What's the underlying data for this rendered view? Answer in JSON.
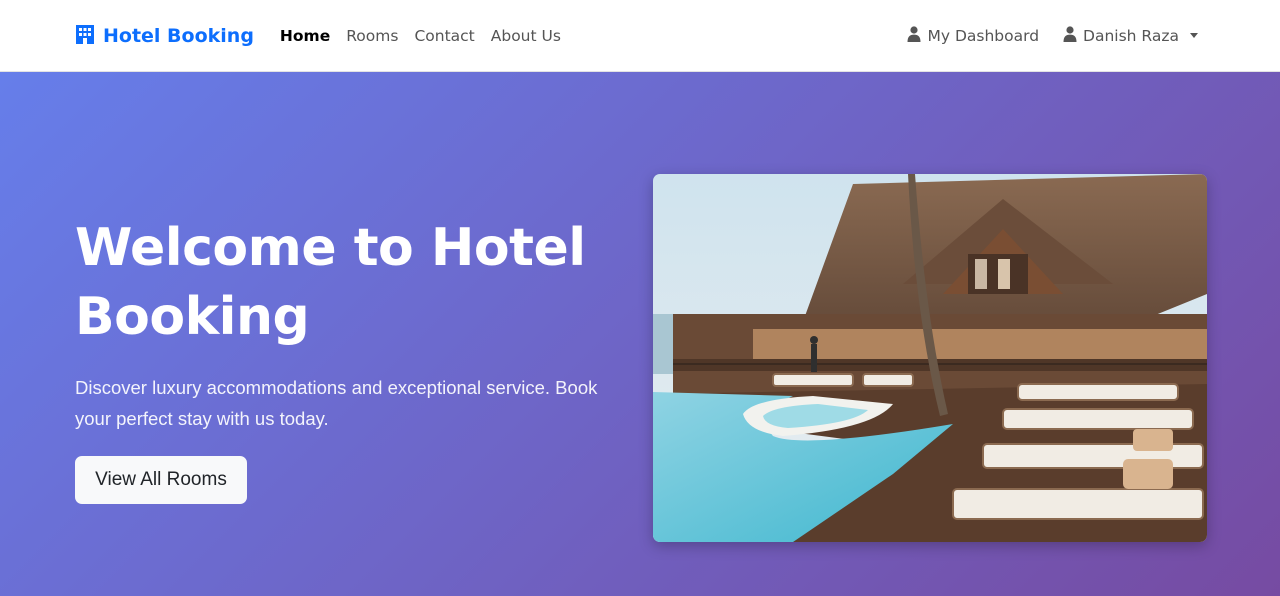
{
  "brand": {
    "name": "Hotel Booking",
    "icon": "building-icon",
    "color": "#0d6efd"
  },
  "nav": {
    "links": [
      {
        "label": "Home",
        "active": true
      },
      {
        "label": "Rooms",
        "active": false
      },
      {
        "label": "Contact",
        "active": false
      },
      {
        "label": "About Us",
        "active": false
      }
    ],
    "dashboard": {
      "label": "My Dashboard",
      "icon": "user-icon"
    },
    "user": {
      "label": "Danish Raza",
      "icon": "user-icon",
      "dropdown": "chevron-down-icon"
    }
  },
  "hero": {
    "title": "Welcome to Hotel Booking",
    "subtitle": "Discover luxury accommodations and exceptional service. Book your perfect stay with us today.",
    "button_label": "View All Rooms",
    "gradient": [
      "#667eea",
      "#764ba2"
    ]
  }
}
